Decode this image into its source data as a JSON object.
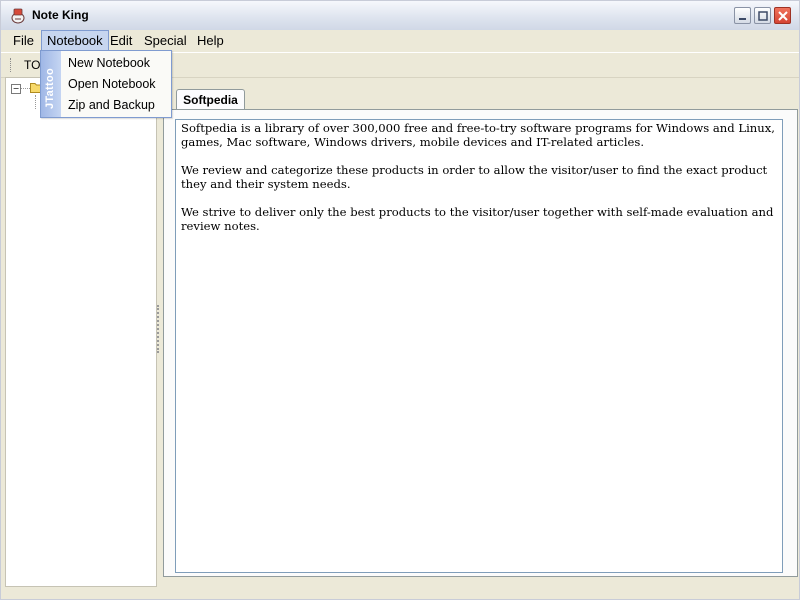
{
  "window": {
    "title": "Note King"
  },
  "menubar": {
    "items": [
      "File",
      "Notebook",
      "Edit",
      "Special",
      "Help"
    ]
  },
  "notebook_menu": {
    "side_label": "JTattoo",
    "items": [
      "New Notebook",
      "Open Notebook",
      "Zip and Backup"
    ]
  },
  "toolbar": {
    "label": "TO"
  },
  "tab": {
    "label": "Softpedia"
  },
  "editor": {
    "paragraphs": [
      "Softpedia is a library of over 300,000 free and free-to-try software programs for Windows and Linux, games, Mac software, Windows drivers, mobile devices and IT-related articles.",
      "We review and categorize these products in order to allow the visitor/user to find the exact product they and their system needs.",
      "We strive to deliver only the best products to the visitor/user together with self-made evaluation and review notes."
    ]
  },
  "colors": {
    "accent": "#7f9bd0",
    "menu_highlight": "#c7d6ef",
    "close_button": "#d54433"
  }
}
